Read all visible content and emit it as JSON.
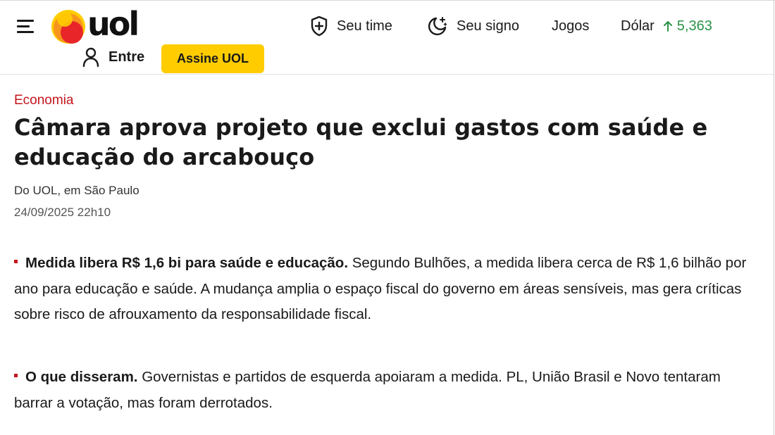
{
  "header": {
    "logo_text": "uol",
    "nav": {
      "seu_time": "Seu time",
      "seu_signo": "Seu signo",
      "jogos": "Jogos",
      "dolar_label": "Dólar",
      "dolar_value": "5,363"
    },
    "login_label": "Entre",
    "subscribe_label": "Assine UOL"
  },
  "article": {
    "section": "Economia",
    "headline": "Câmara aprova projeto que exclui gastos com saúde e educação do arcabouço",
    "byline": "Do UOL, em São Paulo",
    "date": "24/09/2025 22h10",
    "paragraphs": [
      {
        "lead": "Medida libera R$ 1,6 bi para saúde e educação.",
        "text": " Segundo Bulhões, a medida libera cerca de R$ 1,6 bilhão por ano para educação e saúde. A mudança amplia o espaço fiscal do governo em áreas sensíveis, mas gera críticas sobre risco de afrouxamento da responsabilidade fiscal."
      },
      {
        "lead": "O que disseram.",
        "text": " Governistas e partidos de esquerda apoiaram a medida. PL, União Brasil e Novo tentaram barrar a votação, mas foram derrotados."
      }
    ]
  },
  "colors": {
    "brand_yellow": "#ffcc00",
    "brand_orange": "#f7941d",
    "brand_red": "#e8262a",
    "section_red": "#c4161c",
    "up_green": "#2b9348"
  },
  "icons": {
    "menu": "hamburger-menu-icon",
    "team": "shield-plus-icon",
    "horoscope": "moon-stars-icon",
    "trend": "arrow-up-icon",
    "user": "user-icon"
  }
}
